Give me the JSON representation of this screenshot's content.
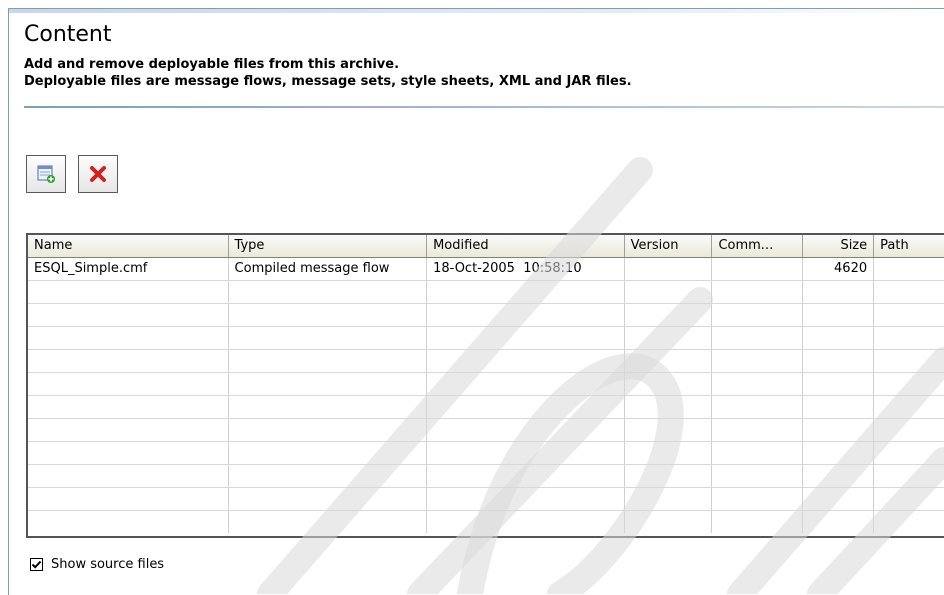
{
  "section": {
    "title": "Content",
    "description_line1": "Add and remove deployable files from this archive.",
    "description_line2": "Deployable files are message flows, message sets, style sheets, XML and JAR files."
  },
  "toolbar": {
    "add_icon": "add-file-icon",
    "remove_icon": "delete-x-icon",
    "remove_color": "#d62020"
  },
  "table": {
    "columns": [
      "Name",
      "Type",
      "Modified",
      "Version",
      "Comm...",
      "Size",
      "Path"
    ],
    "rows": [
      [
        "ESQL_Simple.cmf",
        "Compiled message flow",
        "18-Oct-2005  10:58:10",
        "",
        "",
        "4620",
        ""
      ]
    ]
  },
  "options": {
    "show_source_label": "Show source files",
    "show_source_checked": true
  }
}
